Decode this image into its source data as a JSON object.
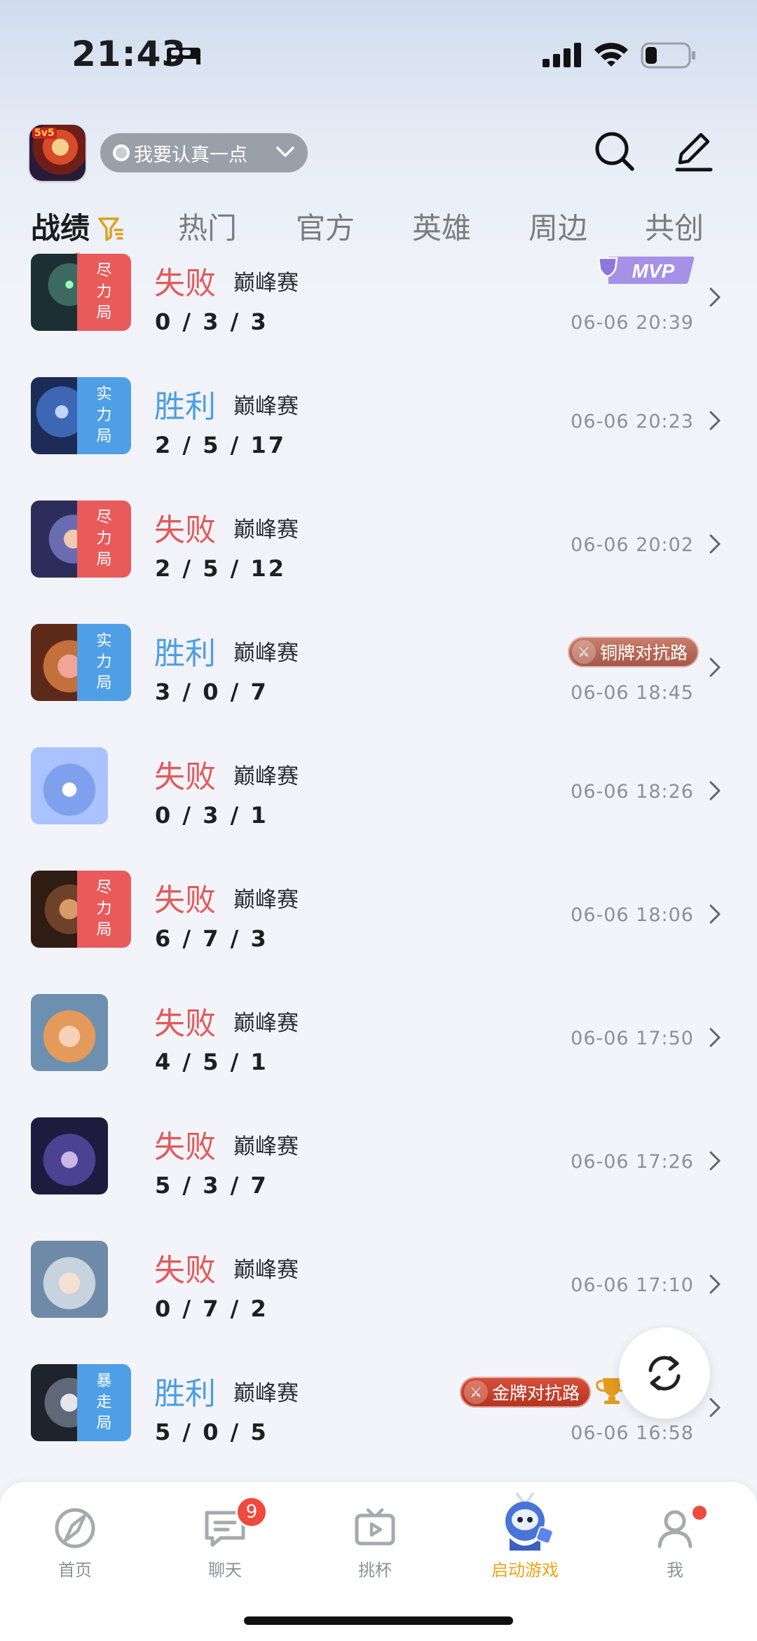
{
  "status_bar": {
    "time": "21:43"
  },
  "header": {
    "motto": "我要认真一点",
    "app_icon_tag": "5v5"
  },
  "tabs": [
    {
      "label": "战绩",
      "active": true
    },
    {
      "label": "热门",
      "active": false
    },
    {
      "label": "官方",
      "active": false
    },
    {
      "label": "英雄",
      "active": false
    },
    {
      "label": "周边",
      "active": false
    },
    {
      "label": "共创",
      "active": false
    }
  ],
  "matches": [
    {
      "result": "失败",
      "outcome": "lose",
      "mode": "巅峰赛",
      "kda": "0 / 3 / 3",
      "time": "06-06 20:39",
      "tag": [
        "尽",
        "力",
        "局"
      ],
      "tag_color": "red",
      "badge": "MVP",
      "hero_color": "#2a4a4a"
    },
    {
      "result": "胜利",
      "outcome": "win",
      "mode": "巅峰赛",
      "kda": "2 / 5 / 17",
      "time": "06-06 20:23",
      "tag": [
        "实",
        "力",
        "局"
      ],
      "tag_color": "blue",
      "hero_color": "#2d4a86"
    },
    {
      "result": "失败",
      "outcome": "lose",
      "mode": "巅峰赛",
      "kda": "2 / 5 / 12",
      "time": "06-06 20:02",
      "tag": [
        "尽",
        "力",
        "局"
      ],
      "tag_color": "red",
      "hero_color": "#5a5d9a"
    },
    {
      "result": "胜利",
      "outcome": "win",
      "mode": "巅峰赛",
      "kda": "3 / 0 / 7",
      "time": "06-06 18:45",
      "tag": [
        "实",
        "力",
        "局"
      ],
      "tag_color": "blue",
      "badge": "铜牌对抗路",
      "hero_color": "#b3683c"
    },
    {
      "result": "失败",
      "outcome": "lose",
      "mode": "巅峰赛",
      "kda": "0 / 3 / 1",
      "time": "06-06 18:26",
      "hero_color": "#6c88d6"
    },
    {
      "result": "失败",
      "outcome": "lose",
      "mode": "巅峰赛",
      "kda": "6 / 7 / 3",
      "time": "06-06 18:06",
      "tag": [
        "尽",
        "力",
        "局"
      ],
      "tag_color": "red",
      "hero_color": "#5a3a28"
    },
    {
      "result": "失败",
      "outcome": "lose",
      "mode": "巅峰赛",
      "kda": "4 / 5 / 1",
      "time": "06-06 17:50",
      "hero_color": "#d7965a"
    },
    {
      "result": "失败",
      "outcome": "lose",
      "mode": "巅峰赛",
      "kda": "5 / 3 / 7",
      "time": "06-06 17:26",
      "hero_color": "#3b3870"
    },
    {
      "result": "失败",
      "outcome": "lose",
      "mode": "巅峰赛",
      "kda": "0 / 7 / 2",
      "time": "06-06 17:10",
      "hero_color": "#9aa7b5"
    },
    {
      "result": "胜利",
      "outcome": "win",
      "mode": "巅峰赛",
      "kda": "5 / 0 / 5",
      "time": "06-06 16:58",
      "tag": [
        "暴",
        "走",
        "局"
      ],
      "tag_color": "blue",
      "badge": "金牌对抗路",
      "hero_color": "#2c3440"
    }
  ],
  "bottom_nav": [
    {
      "label": "首页",
      "icon": "compass-icon"
    },
    {
      "label": "聊天",
      "icon": "chat-icon",
      "badge": "9"
    },
    {
      "label": "挑杯",
      "icon": "tv-icon"
    },
    {
      "label": "启动游戏",
      "icon": "game-mascot-icon",
      "active": true
    },
    {
      "label": "我",
      "icon": "user-icon",
      "dot": true
    }
  ],
  "colors": {
    "lose": "#e25a5a",
    "win": "#4e9ee0",
    "accent": "#f1a21a"
  }
}
